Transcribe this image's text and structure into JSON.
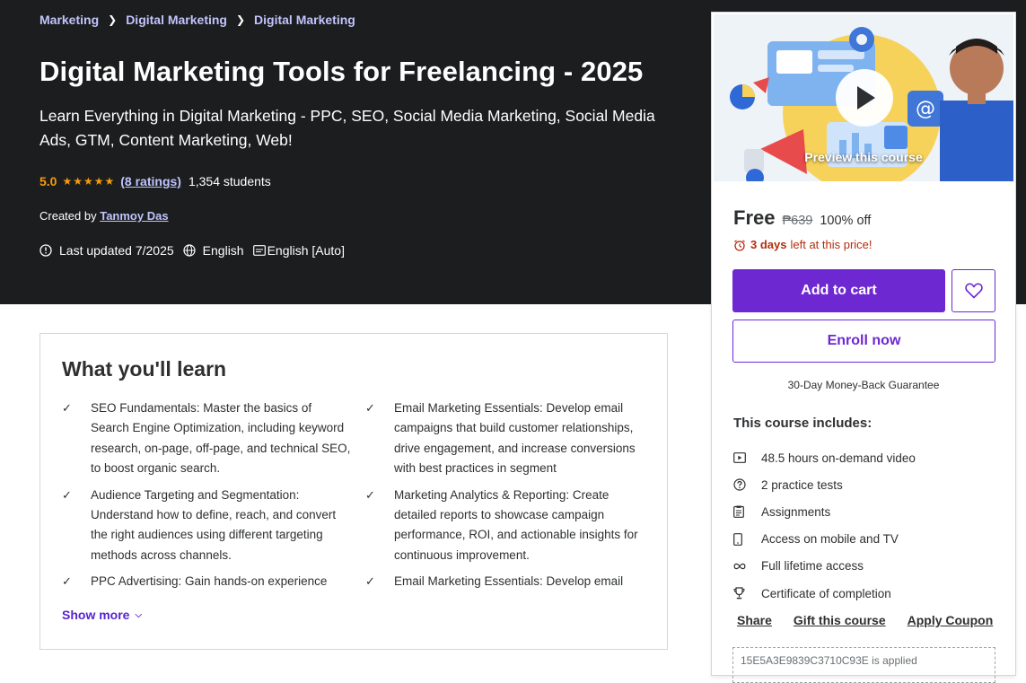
{
  "breadcrumbs": [
    "Marketing",
    "Digital Marketing",
    "Digital Marketing"
  ],
  "course": {
    "title": "Digital Marketing Tools for Freelancing - 2025",
    "subtitle": "Learn Everything in Digital Marketing - PPC, SEO, Social Media Marketing, Social Media Ads, GTM, Content Marketing, Web!",
    "rating": "5.0",
    "stars": 5,
    "ratings_link": "(8 ratings)",
    "students": "1,354 students",
    "created_by_label": "Created by",
    "author": "Tanmoy Das",
    "last_updated": "Last updated 7/2025",
    "language": "English",
    "captions": "English [Auto]"
  },
  "learn": {
    "heading": "What you'll learn",
    "items": [
      "SEO Fundamentals: Master the basics of Search Engine Optimization, including keyword research, on-page, off-page, and technical SEO, to boost organic search.",
      "Email Marketing Essentials: Develop email campaigns that build customer relationships, drive engagement, and increase conversions with best practices in segment",
      "Audience Targeting and Segmentation: Understand how to define, reach, and convert the right audiences using different targeting methods across channels.",
      "Marketing Analytics & Reporting: Create detailed reports to showcase campaign performance, ROI, and actionable insights for continuous improvement.",
      "PPC Advertising: Gain hands-on experience with...",
      "Email Marketing Essentials: Develop email campaigns that build customer relationships"
    ],
    "show_more": "Show more"
  },
  "sidebar": {
    "preview_label": "Preview this course",
    "price": "Free",
    "old_price": "₱639",
    "discount": "100% off",
    "timer_bold": "3 days",
    "timer_rest": "left at this price!",
    "add_to_cart": "Add to cart",
    "enroll": "Enroll now",
    "guarantee": "30-Day Money-Back Guarantee",
    "includes_heading": "This course includes:",
    "includes": [
      {
        "icon": "video-icon",
        "text": "48.5 hours on-demand video"
      },
      {
        "icon": "question-icon",
        "text": "2 practice tests"
      },
      {
        "icon": "assignment-icon",
        "text": "Assignments"
      },
      {
        "icon": "mobile-icon",
        "text": "Access on mobile and TV"
      },
      {
        "icon": "infinity-icon",
        "text": "Full lifetime access"
      },
      {
        "icon": "trophy-icon",
        "text": "Certificate of completion"
      }
    ],
    "share": "Share",
    "gift": "Gift this course",
    "apply_coupon": "Apply Coupon",
    "coupon_text": "15E5A3E9839C3710C93E is applied"
  },
  "colors": {
    "hero_bg": "#1c1d1f",
    "accent": "#6d28d2",
    "link": "#c0c4fc",
    "star": "#f69c08",
    "timer": "#b32d0f"
  }
}
